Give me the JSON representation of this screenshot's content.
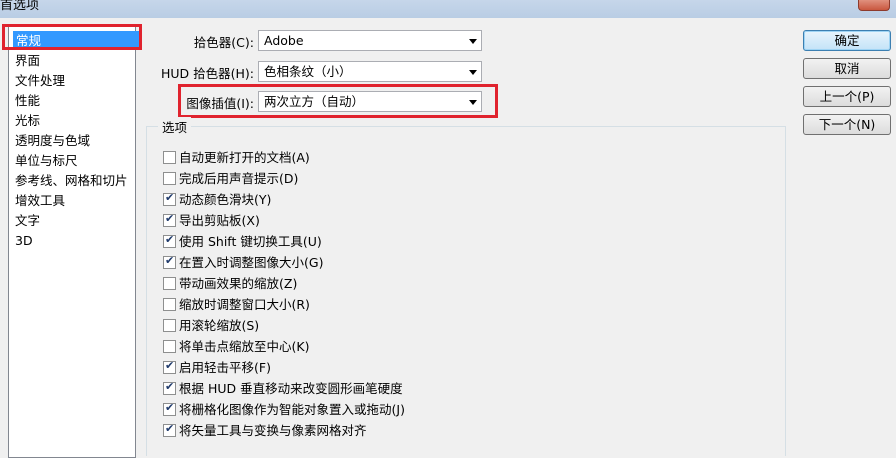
{
  "window": {
    "title": "首选项"
  },
  "sidebar": {
    "items": [
      {
        "label": "常规",
        "selected": true
      },
      {
        "label": "界面"
      },
      {
        "label": "文件处理"
      },
      {
        "label": "性能"
      },
      {
        "label": "光标"
      },
      {
        "label": "透明度与色域"
      },
      {
        "label": "单位与标尺"
      },
      {
        "label": "参考线、网格和切片"
      },
      {
        "label": "增效工具"
      },
      {
        "label": "文字"
      },
      {
        "label": "3D"
      }
    ]
  },
  "settings": {
    "color_picker": {
      "label": "拾色器(C):",
      "value": "Adobe"
    },
    "hud_color_picker": {
      "label": "HUD 拾色器(H):",
      "value": "色相条纹（小）"
    },
    "image_interpolation": {
      "label": "图像插值(I):",
      "value": "两次立方（自动）"
    }
  },
  "options": {
    "title": "选项",
    "items": [
      {
        "label": "自动更新打开的文档(A)",
        "checked": false
      },
      {
        "label": "完成后用声音提示(D)",
        "checked": false
      },
      {
        "label": "动态颜色滑块(Y)",
        "checked": true
      },
      {
        "label": "导出剪贴板(X)",
        "checked": true
      },
      {
        "label": "使用 Shift 键切换工具(U)",
        "checked": true
      },
      {
        "label": "在置入时调整图像大小(G)",
        "checked": true
      },
      {
        "label": "带动画效果的缩放(Z)",
        "checked": false
      },
      {
        "label": "缩放时调整窗口大小(R)",
        "checked": false
      },
      {
        "label": "用滚轮缩放(S)",
        "checked": false
      },
      {
        "label": "将单击点缩放至中心(K)",
        "checked": false
      },
      {
        "label": "启用轻击平移(F)",
        "checked": true
      },
      {
        "label": "根据 HUD 垂直移动来改变圆形画笔硬度",
        "checked": true
      },
      {
        "label": "将栅格化图像作为智能对象置入或拖动(J)",
        "checked": true
      },
      {
        "label": "将矢量工具与变换与像素网格对齐",
        "checked": true
      }
    ]
  },
  "buttons": {
    "ok": "确定",
    "cancel": "取消",
    "prev": "上一个(P)",
    "next": "下一个(N)"
  },
  "colors": {
    "selection": "#3399ff",
    "highlight_box": "#e0232e"
  }
}
